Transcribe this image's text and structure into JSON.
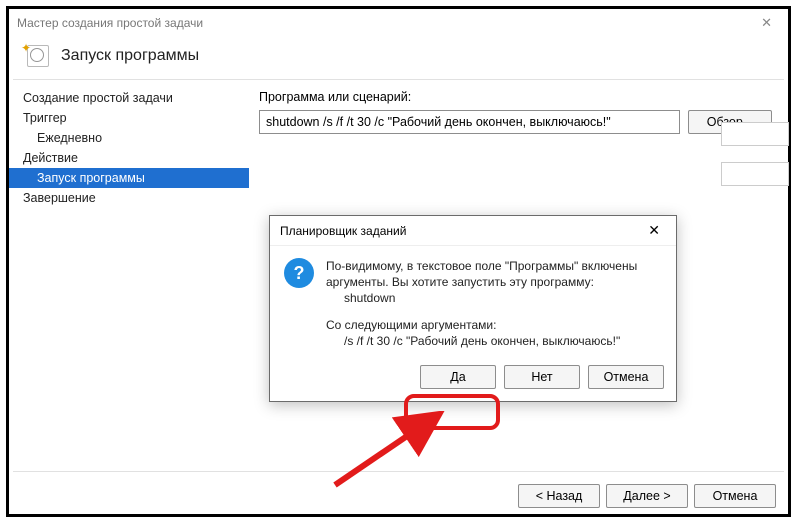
{
  "window": {
    "title": "Мастер создания простой задачи"
  },
  "header": {
    "title": "Запуск программы"
  },
  "sidebar": {
    "items": [
      {
        "label": "Создание простой задачи"
      },
      {
        "label": "Триггер"
      },
      {
        "label": "Ежедневно"
      },
      {
        "label": "Действие"
      },
      {
        "label": "Запуск программы"
      },
      {
        "label": "Завершение"
      }
    ]
  },
  "main": {
    "program_label": "Программа или сценарий:",
    "program_value": "shutdown /s /f /t 30 /c \"Рабочий день окончен, выключаюсь!\"",
    "browse_label": "Обзор..."
  },
  "modal": {
    "title": "Планировщик заданий",
    "line1": "По-видимому, в текстовое поле \"Программы\" включены",
    "line2": "аргументы. Вы хотите запустить эту программу:",
    "program": "shutdown",
    "args_label": "Со следующими аргументами:",
    "args_value": "/s /f /t 30 /c \"Рабочий день окончен, выключаюсь!\"",
    "yes": "Да",
    "no": "Нет",
    "cancel": "Отмена"
  },
  "footer": {
    "back": "< Назад",
    "next": "Далее >",
    "cancel": "Отмена"
  }
}
